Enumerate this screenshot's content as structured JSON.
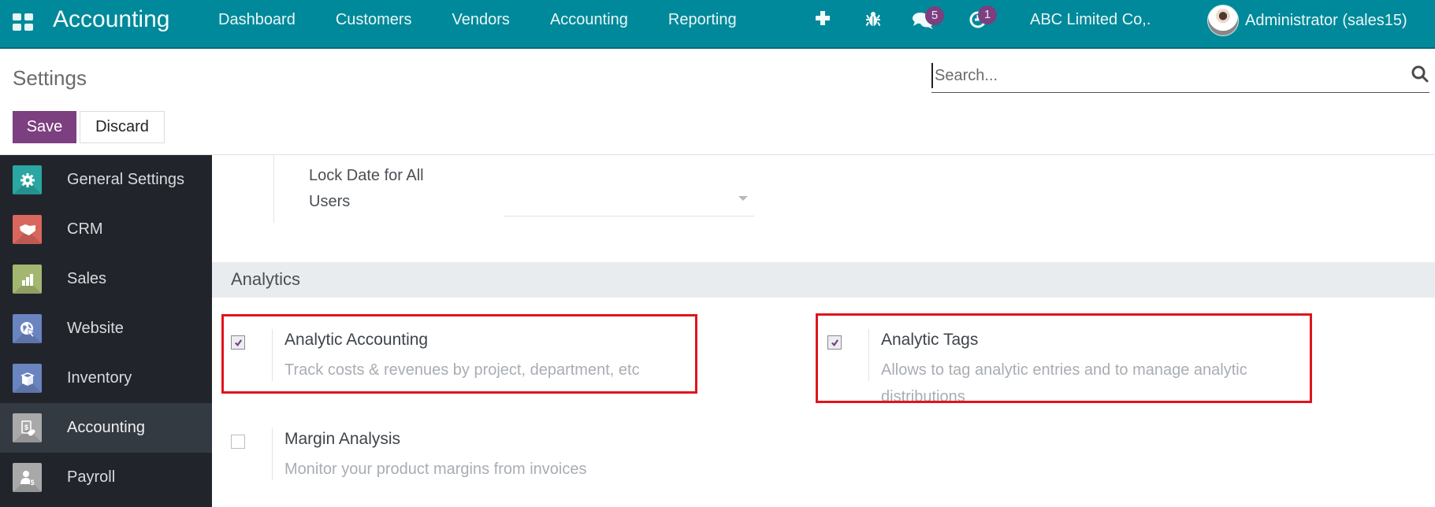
{
  "navbar": {
    "app_name": "Accounting",
    "menu": [
      {
        "label": "Dashboard"
      },
      {
        "label": "Customers"
      },
      {
        "label": "Vendors"
      },
      {
        "label": "Accounting"
      },
      {
        "label": "Reporting"
      }
    ],
    "icons": {
      "apps": "grid-icon",
      "quick_create": "plus-icon",
      "debug": "bug-icon",
      "messages": "chat-icon",
      "activities": "clock-icon"
    },
    "messages_count": "5",
    "activities_count": "1",
    "company": "ABC Limited Co,.",
    "user": "Administrator (sales15)",
    "color": "#00899a",
    "badge_color": "#7c3f7f"
  },
  "control_panel": {
    "title": "Settings",
    "save_label": "Save",
    "discard_label": "Discard",
    "search_placeholder": "Search...",
    "search_value": "",
    "save_color": "#7c3f80"
  },
  "sidebar": {
    "items": [
      {
        "label": "General Settings",
        "icon": "gear-icon",
        "color": "#2aa6a3",
        "active": false
      },
      {
        "label": "CRM",
        "icon": "handshake-icon",
        "color": "#d9675e",
        "active": false
      },
      {
        "label": "Sales",
        "icon": "chart-icon",
        "color": "#a4b770",
        "active": false
      },
      {
        "label": "Website",
        "icon": "globe-icon",
        "color": "#6a84c0",
        "active": false
      },
      {
        "label": "Inventory",
        "icon": "box-icon",
        "color": "#6a84c0",
        "active": false
      },
      {
        "label": "Accounting",
        "icon": "invoice-icon",
        "color": "#a9a9a9",
        "active": true
      },
      {
        "label": "Payroll",
        "icon": "person-dollar-icon",
        "color": "#a9a9a9",
        "active": false
      }
    ]
  },
  "main": {
    "lock_date": {
      "label": "Lock Date for All Users",
      "value": ""
    },
    "section_title": "Analytics",
    "settings": [
      {
        "title": "Analytic Accounting",
        "description": "Track costs & revenues by project, department, etc",
        "checked": true,
        "highlighted": true
      },
      {
        "title": "Analytic Tags",
        "description": "Allows to tag analytic entries and to manage analytic distributions",
        "checked": true,
        "highlighted": true
      },
      {
        "title": "Margin Analysis",
        "description": "Monitor your product margins from invoices",
        "checked": false,
        "highlighted": false
      }
    ],
    "highlight_color": "#e0141e"
  }
}
